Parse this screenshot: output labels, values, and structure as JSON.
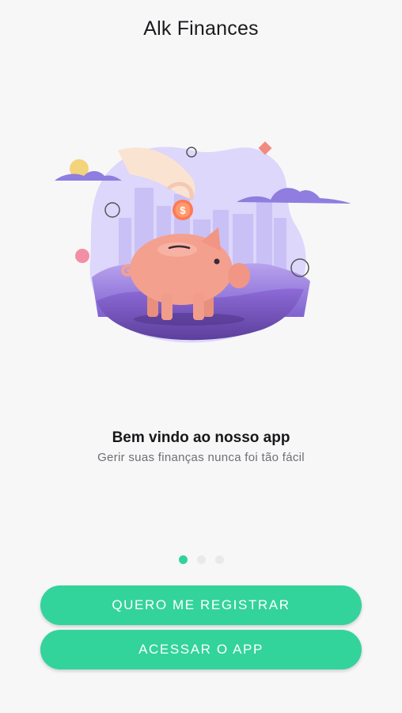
{
  "header": {
    "title": "Alk Finances"
  },
  "hero": {
    "coin_symbol": "$",
    "illustration_icon": "piggy-bank-coin-illustration"
  },
  "onboarding": {
    "title": "Bem vindo ao nosso app",
    "subtitle": "Gerir suas finanças nunca foi tão fácil",
    "page_indicator": {
      "total": 3,
      "active": 1
    }
  },
  "actions": {
    "register_label": "QUERO ME REGISTRAR",
    "access_label": "ACESSAR O APP"
  },
  "colors": {
    "accent": "#33d39c",
    "background": "#f7f7f8",
    "blob": "#dcd7fb",
    "pig": "#f4a08f"
  }
}
